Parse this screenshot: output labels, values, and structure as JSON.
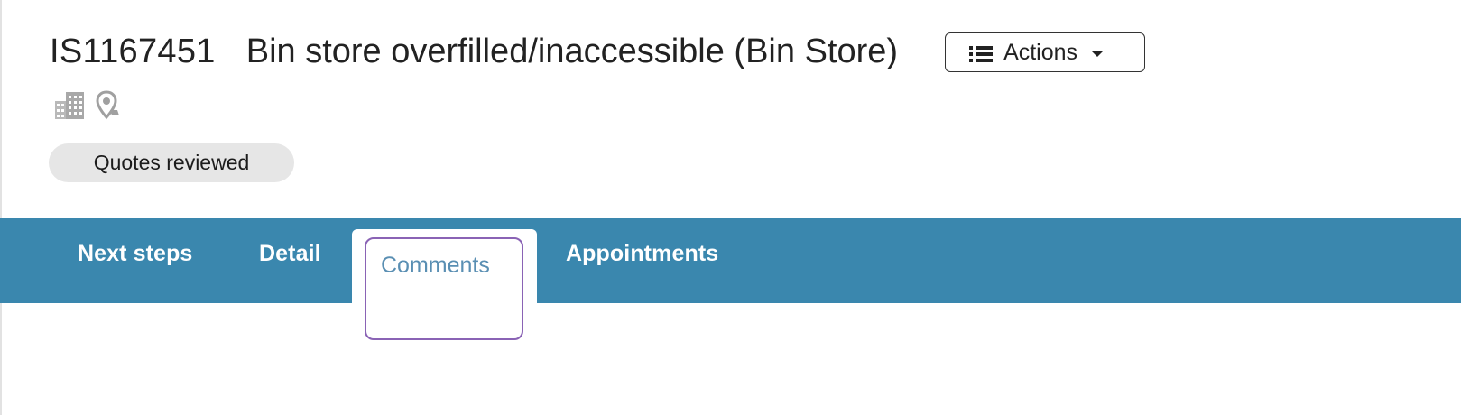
{
  "header": {
    "case_id": "IS1167451",
    "case_title": "Bin store overfilled/inaccessible (Bin Store)",
    "actions_label": "Actions"
  },
  "meta_icons": [
    "building-icon",
    "location-pin-icon"
  ],
  "status": {
    "label": "Quotes reviewed"
  },
  "tabs": [
    {
      "label": "Next steps",
      "active": false
    },
    {
      "label": "Detail",
      "active": false
    },
    {
      "label": "Comments",
      "active": true
    },
    {
      "label": "Appointments",
      "active": false
    }
  ],
  "colors": {
    "tabbar": "#3a87ae",
    "active_tab_text": "#5a8fb3",
    "focus_ring": "#8a63b5",
    "badge_bg": "#e6e6e6"
  }
}
